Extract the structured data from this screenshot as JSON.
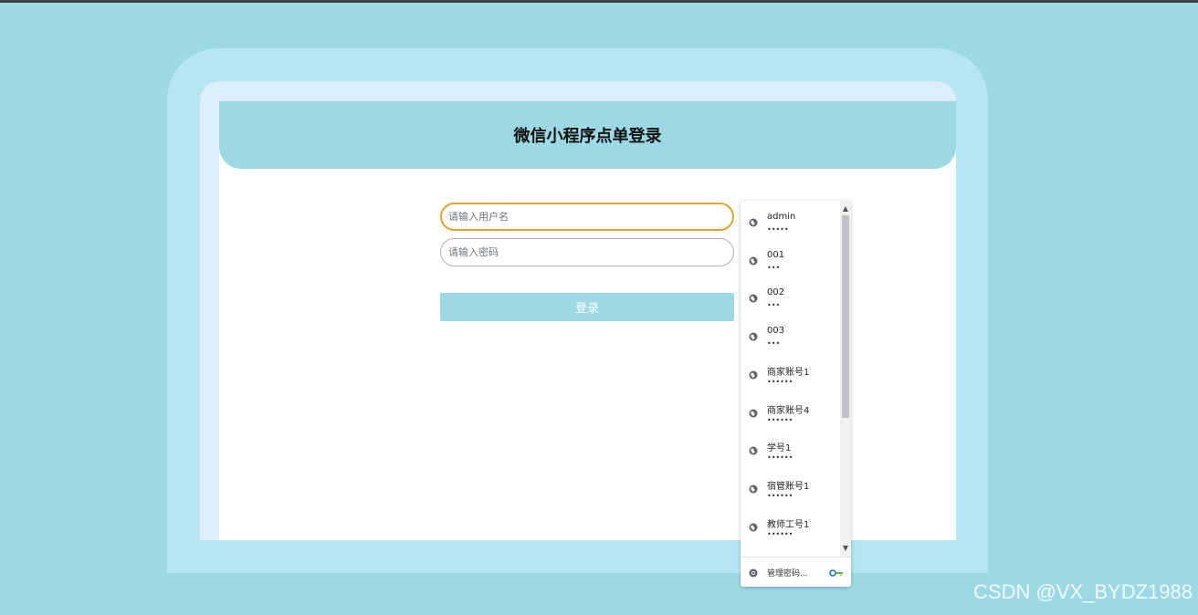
{
  "page": {
    "title": "微信小程序点单登录"
  },
  "form": {
    "username_placeholder": "请输入用户名",
    "password_placeholder": "请输入密码",
    "login_label": "登录"
  },
  "autofill": {
    "items": [
      {
        "name": "admin",
        "mask": "•••••"
      },
      {
        "name": "001",
        "mask": "•••"
      },
      {
        "name": "002",
        "mask": "•••"
      },
      {
        "name": "003",
        "mask": "•••"
      },
      {
        "name": "商家账号1",
        "mask": "••••••"
      },
      {
        "name": "商家账号4",
        "mask": "••••••"
      },
      {
        "name": "学号1",
        "mask": "••••••"
      },
      {
        "name": "宿管账号1",
        "mask": "••••••"
      },
      {
        "name": "教师工号1",
        "mask": "••••••"
      }
    ],
    "footer_label": "管理密码...",
    "icons": {
      "item": "globe-icon",
      "footer": "chrome-icon",
      "key": "key-icon"
    }
  },
  "watermark": "CSDN @VX_BYDZ1988",
  "colors": {
    "background": "#9dd9e5",
    "frame_outer": "#b7e5f2",
    "frame_inner": "#dbeffa",
    "header": "#9dd9e5",
    "focus_border": "#e0a52c",
    "button": "#9dd9e5"
  }
}
